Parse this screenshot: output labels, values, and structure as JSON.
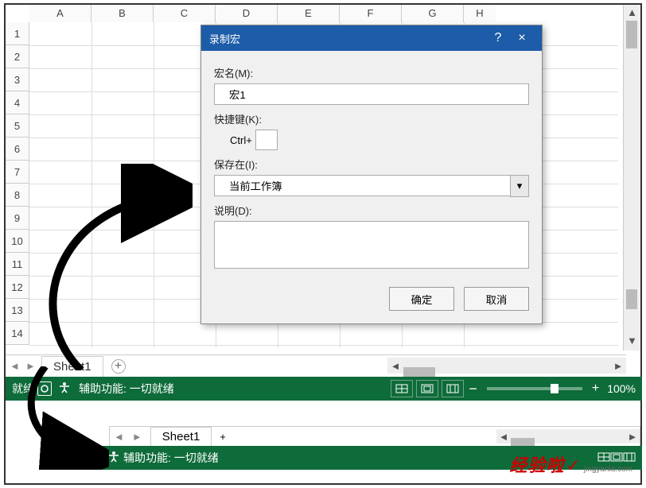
{
  "columns": [
    "A",
    "B",
    "C",
    "D",
    "E",
    "F",
    "G",
    "H"
  ],
  "rows": [
    "1",
    "2",
    "3",
    "4",
    "5",
    "6",
    "7",
    "8",
    "9",
    "10",
    "11",
    "12",
    "13",
    "14"
  ],
  "sheet": {
    "tab": "Sheet1",
    "add": "+"
  },
  "status1": {
    "ready": "就绪",
    "accessibility": "辅助功能: 一切就绪",
    "zoom": "100%",
    "minus": "−",
    "plus": "+"
  },
  "status2": {
    "accessibility": "辅助功能: 一切就绪"
  },
  "dialog": {
    "title": "录制宏",
    "help": "?",
    "close": "×",
    "name_label": "宏名(M):",
    "name_value": "宏1",
    "shortcut_label": "快捷键(K):",
    "ctrl": "Ctrl+",
    "save_label": "保存在(I):",
    "save_value": "当前工作簿",
    "desc_label": "说明(D):",
    "desc_value": "",
    "ok": "确定",
    "cancel": "取消"
  },
  "watermark": {
    "big": "经验啦",
    "small": "jingyanla.com",
    "check": "✓"
  }
}
